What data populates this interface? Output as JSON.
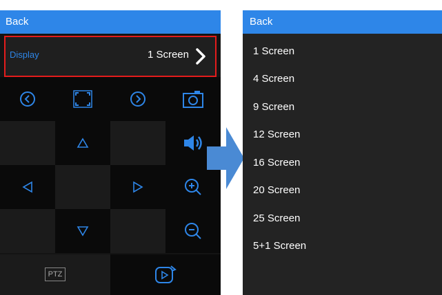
{
  "left": {
    "back_label": "Back",
    "display": {
      "label": "Display",
      "value": "1 Screen"
    },
    "controls": {
      "ptz_label": "PTZ"
    }
  },
  "right": {
    "back_label": "Back",
    "options": [
      "1 Screen",
      "4 Screen",
      "9 Screen",
      "12 Screen",
      "16 Screen",
      "20 Screen",
      "25 Screen",
      "5+1 Screen"
    ]
  },
  "colors": {
    "accent": "#2e86e8",
    "highlight_border": "#e51c1c",
    "panel_bg": "#141414",
    "arrow": "#4a8ad4"
  }
}
